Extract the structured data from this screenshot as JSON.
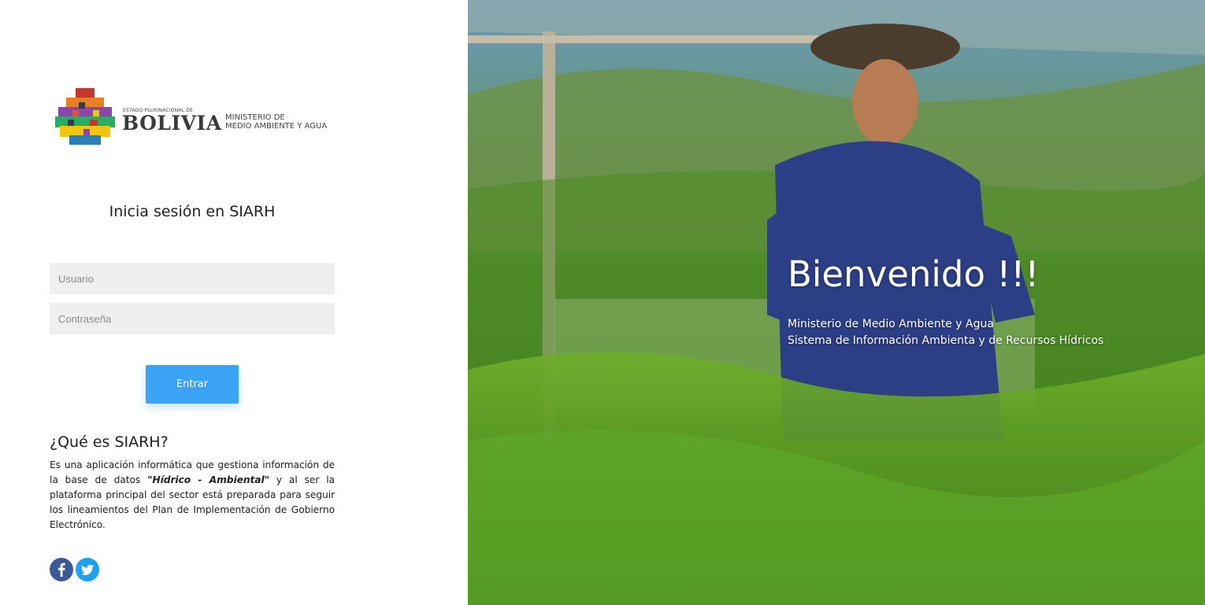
{
  "logo": {
    "estado": "ESTADO PLURINACIONAL DE",
    "country": "BOLIVIA",
    "ministry": "MINISTERIO DE\nMEDIO AMBIENTE Y AGUA"
  },
  "login": {
    "title": "Inicia sesión en SIARH",
    "username_placeholder": "Usuario",
    "password_placeholder": "Contraseña",
    "submit_label": "Entrar"
  },
  "about": {
    "title": "¿Qué es SIARH?",
    "text_before": "Es una aplicación informática que gestiona información de la base de datos ",
    "text_emphasis": "\"Hídrico - Ambiental\"",
    "text_after": " y al ser la plataforma principal del sector está preparada para seguir los lineamientos del Plan de Implementación de Gobierno Electrónico."
  },
  "social": {
    "facebook_icon": "facebook-icon",
    "twitter_icon": "twitter-icon"
  },
  "hero": {
    "title": "Bienvenido !!!",
    "line1": "Ministerio de Medio Ambiente y Agua",
    "line2": "Sistema de Información Ambienta y de Recursos Hídricos"
  },
  "colors": {
    "primary_button": "#3aa3f5",
    "input_background": "#efefef",
    "facebook": "#3b5998",
    "twitter": "#1da1f2"
  }
}
